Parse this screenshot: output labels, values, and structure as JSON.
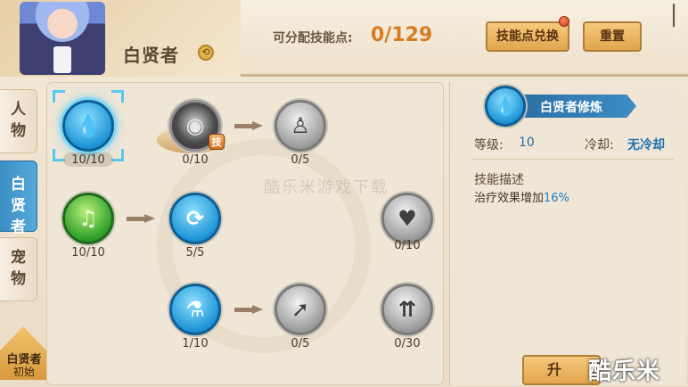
{
  "header": {
    "character_name": "白贤者",
    "points_label": "可分配技能点:",
    "points_value": "0/129",
    "exchange_button": "技能点兑换",
    "reset_button": "重置"
  },
  "tabs": [
    {
      "label_top": "人",
      "label_bottom": "物"
    },
    {
      "label_top": "白",
      "label_mid": "贤",
      "label_bottom": "者"
    },
    {
      "label_top": "宠",
      "label_bottom": "物"
    }
  ],
  "bottom_badge": {
    "line1": "白贤者",
    "line2": "初始"
  },
  "skill_tree": {
    "watermark": "酷乐米游戏下载",
    "skill_tag": "技",
    "nodes": [
      {
        "icon": "drop-plus-icon",
        "glyph": "💧",
        "count": "10/10"
      },
      {
        "icon": "dark-orb-icon",
        "glyph": "◉",
        "count": "0/10"
      },
      {
        "icon": "figure-icon",
        "glyph": "♙",
        "count": "0/5"
      },
      {
        "icon": "green-swirl-icon",
        "glyph": "♫",
        "count": "10/10"
      },
      {
        "icon": "circular-arrows-icon",
        "glyph": "⟳",
        "count": "5/5"
      },
      {
        "icon": "heart-plus-icon",
        "glyph": "♥",
        "count": "0/10"
      },
      {
        "icon": "vial-icon",
        "glyph": "⚗",
        "count": "1/10"
      },
      {
        "icon": "boost-arrow-icon",
        "glyph": "➚",
        "count": "0/5"
      },
      {
        "icon": "triple-arrows-icon",
        "glyph": "⇈",
        "count": "0/30"
      }
    ]
  },
  "details": {
    "title": "白贤者修炼",
    "icon_glyph": "💧",
    "level_label": "等级:",
    "level_value": "10",
    "cooldown_label": "冷却:",
    "cooldown_value": "无冷却",
    "description_label": "技能描述",
    "description_text": "治疗效果增加",
    "description_value": "16%",
    "action_button": "升",
    "site_logo": "酷乐米"
  },
  "colors": {
    "accent_orange": "#d87c22",
    "active_tab_blue": "#3a8ec2",
    "highlight_blue": "#1f7fc2"
  }
}
